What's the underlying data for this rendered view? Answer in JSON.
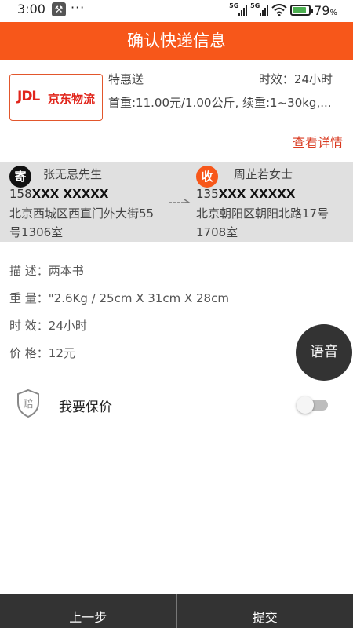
{
  "status_bar": {
    "time": "3:00",
    "dots": "···",
    "signal_label_1": "5G",
    "signal_label_2": "5G",
    "battery_pct": "79",
    "battery_unit": "%"
  },
  "header": {
    "title": "确认快递信息"
  },
  "courier": {
    "logo_text": "JDL",
    "logo_cn": "京东物流",
    "service_name": "特惠送",
    "service_time": "时效：24小时",
    "price_rule": "首重:11.00元/1.00公斤, 续重:1~30kg,...",
    "details_link": "查看详情"
  },
  "sender": {
    "badge": "寄",
    "name": "张无忌先生",
    "phone_prefix": "158",
    "phone_masked": "XXX XXXXX",
    "address": "北京西城区西直门外大街55号1306室"
  },
  "receiver": {
    "badge": "收",
    "name": "周芷若女士",
    "phone_prefix": "135",
    "phone_masked": "XXX XXXXX",
    "address": "北京朝阳区朝阳北路17号1708室"
  },
  "info": {
    "desc_label": "描  述：",
    "desc_value": "两本书",
    "weight_label": "重  量：",
    "weight_value": "\"2.6Kg / 25cm X 31cm X 28cm",
    "time_label": "时  效：",
    "time_value": "24小时",
    "price_label": "价  格：",
    "price_value": "12元"
  },
  "voice_button": "语音",
  "insurance": {
    "icon_char": "赔",
    "label": "我要保价",
    "enabled": false
  },
  "footer": {
    "prev_label": "上一步",
    "submit_label": "提交"
  },
  "colors": {
    "accent": "#f7571a",
    "link": "#d93a20",
    "footer_bg": "#333333",
    "band_bg": "#e0e0e0"
  }
}
